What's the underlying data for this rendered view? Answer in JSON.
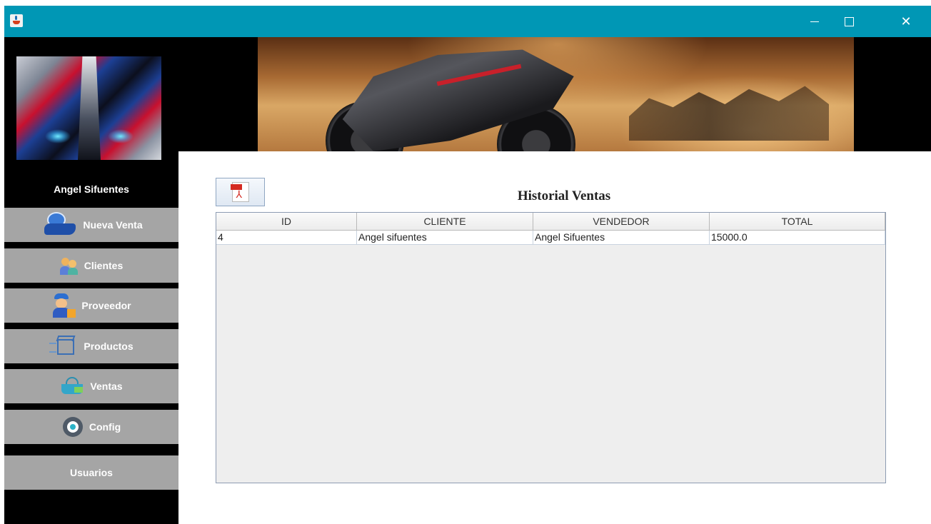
{
  "window": {
    "title": "",
    "controls": {
      "minimize": "—",
      "maximize": "☐",
      "close": "✕"
    }
  },
  "sidebar": {
    "user_name": "Angel Sifuentes",
    "items": [
      {
        "label": "Nueva Venta",
        "icon": "sale-hand-coin-icon"
      },
      {
        "label": "Clientes",
        "icon": "clients-icon"
      },
      {
        "label": "Proveedor",
        "icon": "supplier-icon"
      },
      {
        "label": "Productos",
        "icon": "box-icon"
      },
      {
        "label": "Ventas",
        "icon": "basket-icon"
      },
      {
        "label": "Config",
        "icon": "gear-icon"
      },
      {
        "label": "Usuarios",
        "icon": ""
      }
    ]
  },
  "main": {
    "pdf_button_icon": "pdf-icon",
    "pdf_icon_text": "PDF",
    "title": "Historial Ventas",
    "table": {
      "columns": [
        "ID",
        "CLIENTE",
        "VENDEDOR",
        "TOTAL"
      ],
      "rows": [
        [
          "4",
          "Angel sifuentes",
          "Angel Sifuentes",
          "15000.0"
        ]
      ]
    }
  },
  "colors": {
    "titlebar": "#0097b5",
    "sidebar_bg": "#000000",
    "nav_item_bg": "#a5a5a5",
    "content_bg": "#ffffff",
    "table_empty_bg": "#eeeeee"
  }
}
